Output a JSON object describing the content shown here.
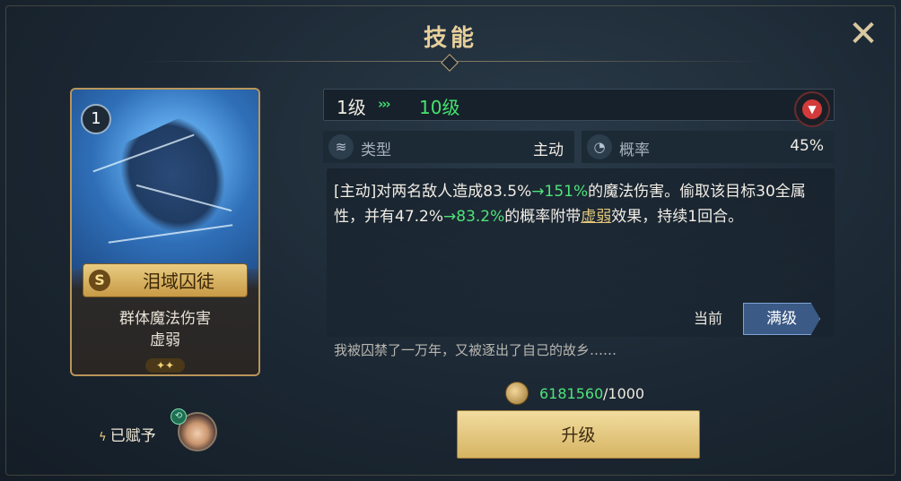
{
  "header": {
    "title": "技能"
  },
  "card": {
    "level": "1",
    "rarity": "S",
    "name": "泪域囚徒",
    "desc_line1": "群体魔法伤害",
    "desc_line2": "虚弱",
    "stars": "✦✦"
  },
  "granted": {
    "label": "已赋予"
  },
  "level_bar": {
    "from": "1级",
    "arrows": "›››",
    "to": "10级"
  },
  "info": {
    "type_label": "类型",
    "type_value": "主动",
    "rate_label": "概率",
    "rate_value": "45%"
  },
  "description": {
    "p1": "[主动]对两名敌人造成83.5%",
    "p2": "→151%",
    "p3": "的魔法伤害。偷取该目标30全属性，并有47.2%",
    "p4": "→83.2%",
    "p5": "的概率附带",
    "p6": "虚弱",
    "p7": "效果，持续1回合。"
  },
  "tabs": {
    "current": "当前",
    "max": "满级"
  },
  "flavor": "我被囚禁了一万年，又被逐出了自己的故乡……",
  "cost": {
    "have": "6181560",
    "need": "/1000"
  },
  "upgrade_button": "升级",
  "colors": {
    "accent_gold": "#e6cf9a",
    "highlight_green": "#4fe37a",
    "tab_blue": "#3b5a86"
  },
  "icons": {
    "close": "close-icon",
    "level_down": "arrow-down-icon",
    "type": "layers-icon",
    "rate": "pie-icon",
    "coin": "coin-icon",
    "bolt": "bolt-icon"
  }
}
